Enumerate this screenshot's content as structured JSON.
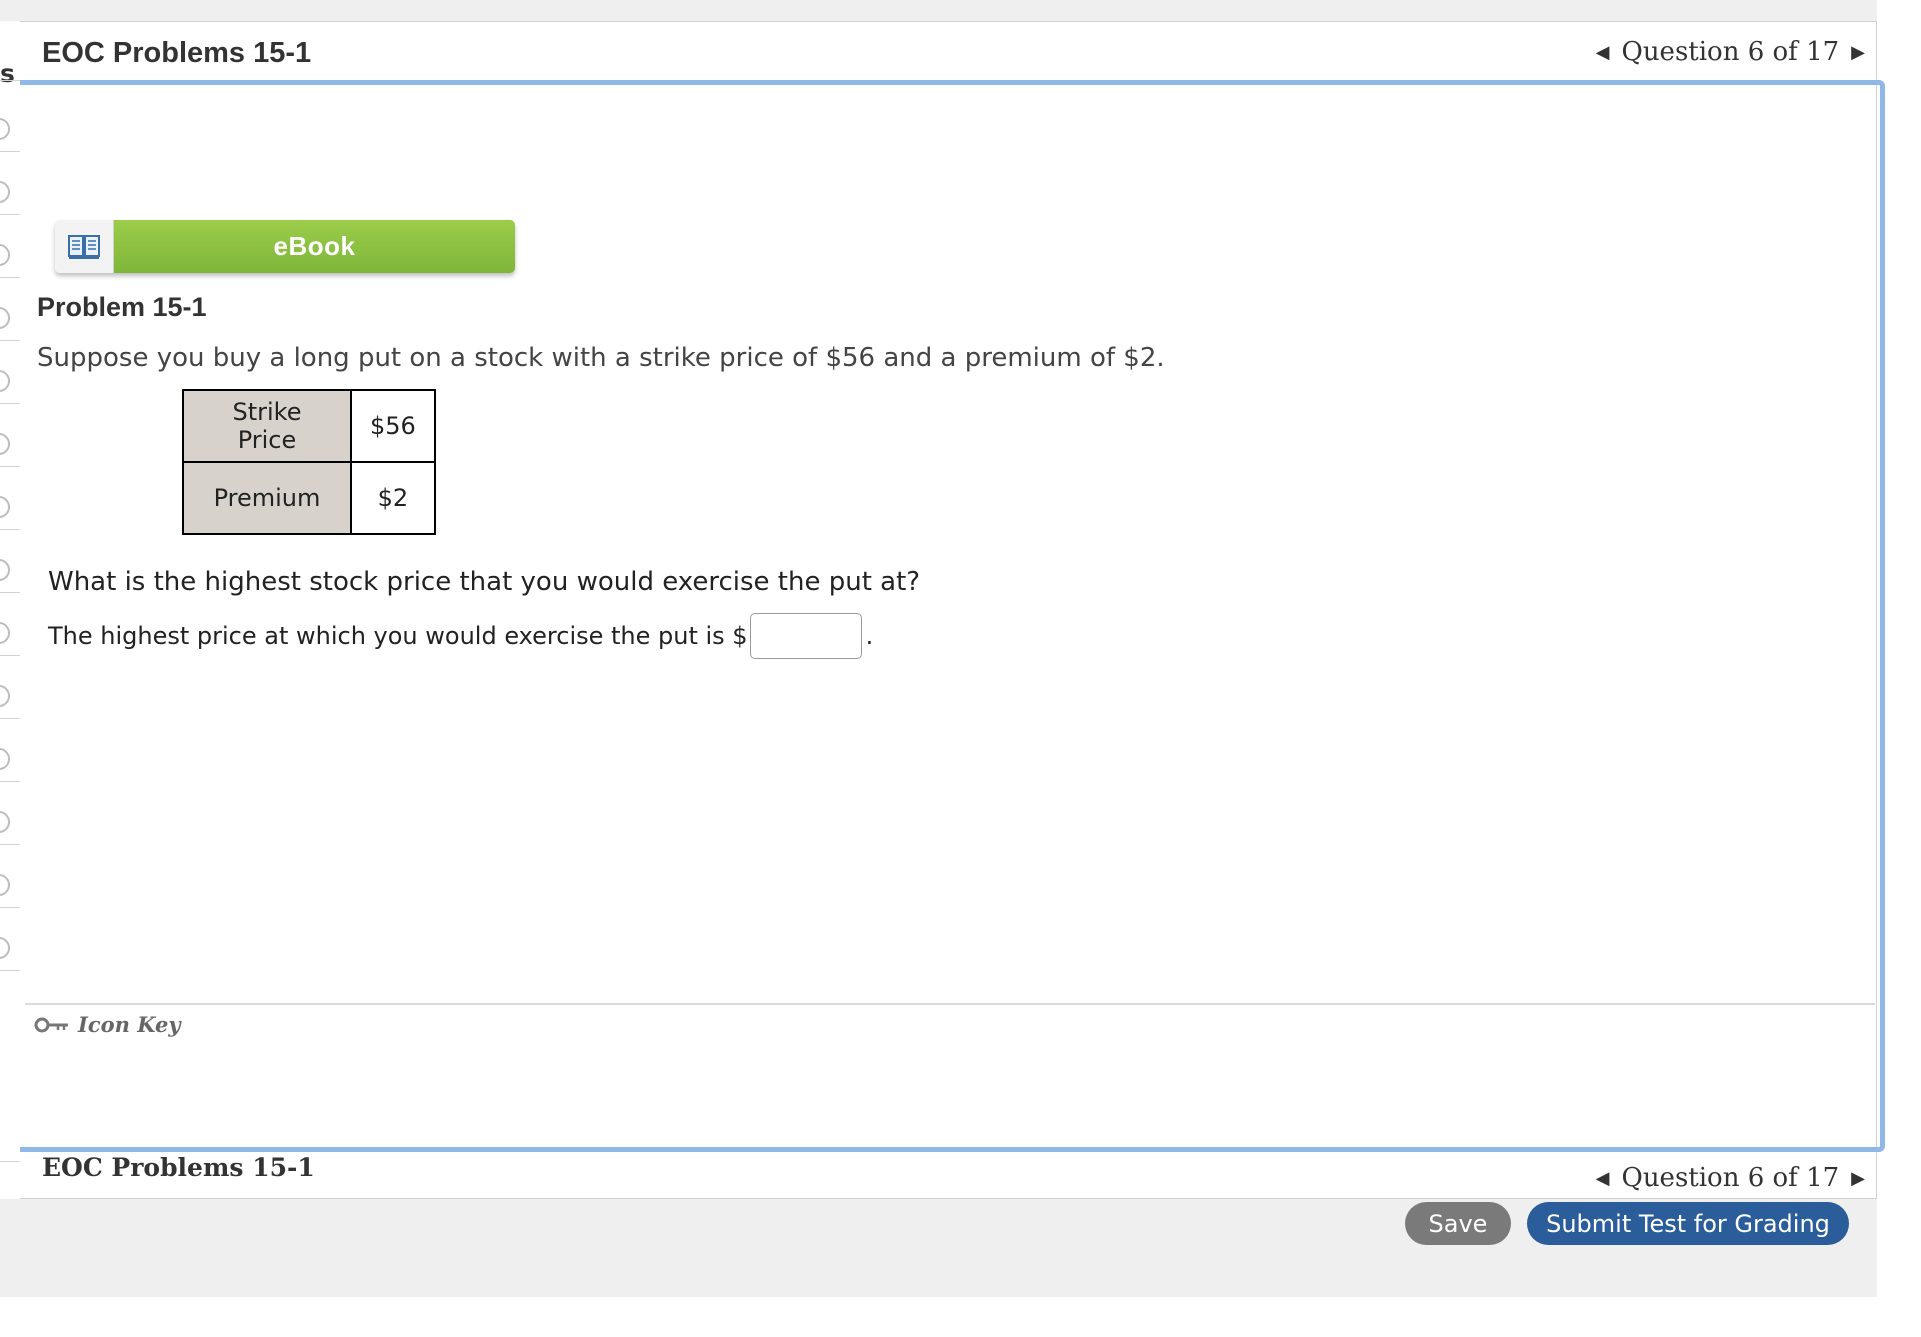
{
  "sidebar": {
    "partial_letter": "s"
  },
  "header": {
    "title": "EOC Problems 15-1",
    "question_nav": {
      "prev_icon": "triangle-left",
      "label": "Question 6 of 17",
      "next_icon": "triangle-right"
    }
  },
  "ebook": {
    "label": "eBook",
    "icon": "open-book-icon"
  },
  "problem": {
    "title": "Problem 15-1",
    "statement": "Suppose you buy a long put on a stock with a strike price of $56 and a premium of $2.",
    "table": [
      {
        "label": "Strike Price",
        "value": "$56"
      },
      {
        "label": "Premium",
        "value": "$2"
      }
    ],
    "question": "What is the highest stock price that you would exercise the put at?",
    "answer_prefix": "The highest price at which you would exercise the put is $",
    "answer_value": "",
    "answer_suffix": "."
  },
  "icon_key": {
    "label": "Icon Key",
    "icon": "key-icon"
  },
  "footer": {
    "title": "EOC Problems 15-1",
    "question_nav": {
      "label": "Question 6 of 17"
    },
    "save_label": "Save",
    "submit_label": "Submit Test for Grading"
  },
  "colors": {
    "ebook_green": "#8bc34a",
    "frame_blue": "#8fb7e8",
    "submit_blue": "#2b5d9b",
    "save_gray": "#7a7a7a",
    "table_header_bg": "#d7d3cc"
  }
}
